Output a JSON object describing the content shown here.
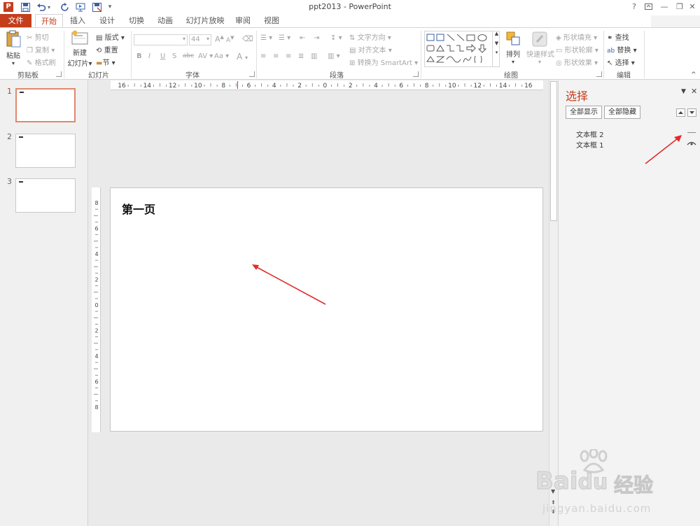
{
  "window": {
    "title": "ppt2013 - PowerPoint",
    "help": "?",
    "restore_ribbon": "▣",
    "minimize": "—",
    "restore": "❐",
    "close": "✕"
  },
  "qat": {
    "app_icon": "P",
    "save_icon": "save-icon",
    "undo_icon": "undo-icon",
    "redo_icon": "redo-icon",
    "present_icon": "present-icon",
    "customize_icon": "customize-icon"
  },
  "tabs": [
    "文件",
    "开始",
    "插入",
    "设计",
    "切换",
    "动画",
    "幻灯片放映",
    "审阅",
    "视图"
  ],
  "ribbon": {
    "clipboard": {
      "paste": "粘贴",
      "cut": "剪切",
      "copy": "复制",
      "format_painter": "格式刷",
      "label": "剪贴板"
    },
    "slides": {
      "new_slide_1": "新建",
      "new_slide_2": "幻灯片",
      "layout": "版式",
      "reset": "重置",
      "section": "节",
      "label": "幻灯片"
    },
    "font": {
      "font_name": "",
      "font_size": "44",
      "grow": "A",
      "shrink": "A",
      "clear": "A",
      "bold": "B",
      "italic": "I",
      "underline": "U",
      "shadow": "S",
      "strike": "abc",
      "spacing": "AV",
      "case": "Aa",
      "color": "A",
      "label": "字体"
    },
    "paragraph": {
      "text_direction": "文字方向",
      "align_text": "对齐文本",
      "smartart": "转换为 SmartArt",
      "label": "段落"
    },
    "drawing": {
      "arrange": "排列",
      "quick_styles": "快速样式",
      "fill": "形状填充",
      "outline": "形状轮廓",
      "effects": "形状效果",
      "label": "绘图"
    },
    "editing": {
      "find": "查找",
      "replace": "替换",
      "select": "选择",
      "label": "编辑"
    }
  },
  "thumbnails": [
    {
      "number": "1",
      "active": true
    },
    {
      "number": "2",
      "active": false
    },
    {
      "number": "3",
      "active": false
    }
  ],
  "ruler": {
    "h_labels": [
      "16",
      "14",
      "12",
      "10",
      "8",
      "6",
      "4",
      "2",
      "0",
      "2",
      "4",
      "6",
      "8",
      "10",
      "12",
      "14",
      "16"
    ],
    "v_labels": [
      "8",
      "6",
      "4",
      "2",
      "0",
      "2",
      "4",
      "6",
      "8"
    ]
  },
  "slide": {
    "title_text": "第一页"
  },
  "selection_pane": {
    "title": "选择",
    "show_all": "全部显示",
    "hide_all": "全部隐藏",
    "items": [
      {
        "name": "文本框 2",
        "visible": false
      },
      {
        "name": "文本框 1",
        "visible": true
      }
    ]
  },
  "colors": {
    "accent": "#c43e1c",
    "annotation": "#e32b2b"
  },
  "watermark": {
    "brand": "Bai",
    "brand2": "du",
    "cn": "经验",
    "url": "jingyan.baidu.com"
  }
}
